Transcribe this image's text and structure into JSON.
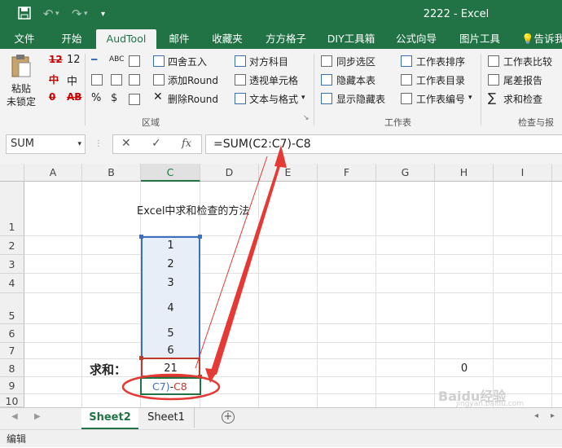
{
  "window": {
    "title": "2222 - Excel"
  },
  "tabs": [
    "文件",
    "开始",
    "AudTool",
    "邮件",
    "收藏夹",
    "方方格子",
    "DIY工具箱",
    "公式向导",
    "图片工具",
    "告诉我"
  ],
  "ribbon": {
    "paste_line1": "粘贴",
    "paste_line2": "未锁定",
    "font_cells": [
      "12",
      "中"
    ],
    "region_items": [
      "四舍五入",
      "添加Round",
      "删除Round"
    ],
    "col3_items": [
      "对方科目",
      "透视单元格",
      "文本与格式"
    ],
    "group_region": "区域",
    "ws_items_a": [
      "同步选区",
      "隐藏本表",
      "显示隐藏表"
    ],
    "ws_items_b": [
      "工作表排序",
      "工作表目录",
      "工作表编号"
    ],
    "group_ws": "工作表",
    "check_items": [
      "工作表比较",
      "尾差报告",
      "求和检查"
    ],
    "group_check": "检查与报告"
  },
  "formula_bar": {
    "namebox": "SUM",
    "fx": "fx",
    "formula": "=SUM(C2:C7)-C8"
  },
  "columns": [
    "A",
    "B",
    "C",
    "D",
    "E",
    "F",
    "G",
    "H",
    "I"
  ],
  "rows": [
    "1",
    "2",
    "3",
    "4",
    "5",
    "6",
    "7",
    "8",
    "9",
    "10"
  ],
  "cells": {
    "title": "Excel中求和检查的方法",
    "c2": "1",
    "c3": "2",
    "c4": "3",
    "c5": "4",
    "c6": "5",
    "c7": "6",
    "b8": "求和：",
    "c8": "21",
    "h8": "0",
    "c9_a": "C7)",
    "c9_b": "-",
    "c9_c": "C8"
  },
  "sheets": [
    "Sheet2",
    "Sheet1"
  ],
  "status": "编辑",
  "watermark": {
    "brand": "Baidu经验",
    "url": "jingyan.baidu.com"
  }
}
